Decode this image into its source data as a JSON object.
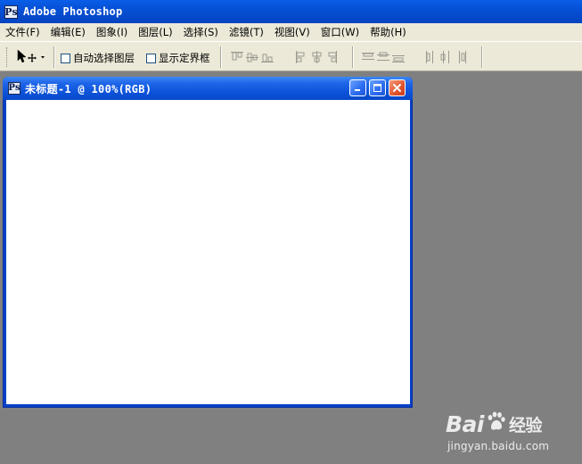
{
  "app": {
    "title": "Adobe Photoshop",
    "icon": "photoshop-app-icon"
  },
  "menu": {
    "items": [
      {
        "label": "文件(F)"
      },
      {
        "label": "编辑(E)"
      },
      {
        "label": "图象(I)"
      },
      {
        "label": "图层(L)"
      },
      {
        "label": "选择(S)"
      },
      {
        "label": "滤镜(T)"
      },
      {
        "label": "视图(V)"
      },
      {
        "label": "窗口(W)"
      },
      {
        "label": "帮助(H)"
      }
    ]
  },
  "options_bar": {
    "tool": "move-tool-icon",
    "auto_select_label": "自动选择图层",
    "auto_select_checked": false,
    "show_bounds_label": "显示定界框",
    "show_bounds_checked": false,
    "align_buttons": [
      "align-top-edges-icon",
      "align-vertical-centers-icon",
      "align-bottom-edges-icon",
      "align-left-edges-icon",
      "align-horizontal-centers-icon",
      "align-right-edges-icon"
    ],
    "distribute_buttons": [
      "distribute-top-icon",
      "distribute-vertical-centers-icon",
      "distribute-bottom-icon",
      "distribute-left-icon",
      "distribute-horizontal-centers-icon",
      "distribute-right-icon"
    ]
  },
  "document": {
    "title": "未标题-1 @ 100%(RGB)",
    "canvas_color": "#ffffff"
  },
  "watermark": {
    "logo_prefix": "Bai",
    "logo_suffix": "经验",
    "url": "jingyan.baidu.com"
  },
  "colors": {
    "workspace": "#808080",
    "xp_blue": "#0848c8",
    "chrome": "#ece9d8",
    "close_red": "#e2542e"
  }
}
